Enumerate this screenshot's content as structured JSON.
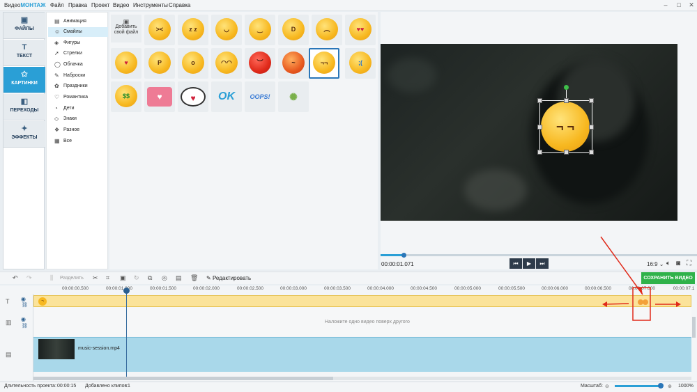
{
  "app": {
    "title_prefix": "Видео",
    "title_brand": "МОНТАЖ"
  },
  "menu": [
    "Файл",
    "Правка",
    "Проект",
    "Видео",
    "Инструменты",
    "Справка"
  ],
  "nav": [
    {
      "label": "ФАЙЛЫ",
      "icon": "image-icon"
    },
    {
      "label": "ТЕКСТ",
      "icon": "text-icon"
    },
    {
      "label": "КАРТИНКИ",
      "icon": "star-icon"
    },
    {
      "label": "ПЕРЕХОДЫ",
      "icon": "transitions-icon"
    },
    {
      "label": "ЭФФЕКТЫ",
      "icon": "magic-wand-icon"
    }
  ],
  "categories": [
    "Анимация",
    "Смайлы",
    "Фигуры",
    "Стрелки",
    "Облачка",
    "Наброски",
    "Праздники",
    "Романтика",
    "Дети",
    "Знаки",
    "Разное",
    "Все"
  ],
  "add_file": {
    "line1": "Добавить",
    "line2": "свой файл"
  },
  "stickers": {
    "ok": "OK",
    "oops": "OOPS!"
  },
  "player": {
    "timecode": "00:00:01.071",
    "ratio": "16:9",
    "progress": 0.07
  },
  "toolbar": {
    "split": "Разделить",
    "edit": "Редактировать",
    "save": "СОХРАНИТЬ ВИДЕО"
  },
  "ruler": [
    "00:00:00.500",
    "00:00:01.000",
    "00:00:01.500",
    "00:00:02.000",
    "00:00:02.500",
    "00:00:03.000",
    "00:00:03.500",
    "00:00:04.000",
    "00:00:04.500",
    "00:00:05.000",
    "00:00:05.500",
    "00:00:06.000",
    "00:00:06.500",
    "00:00:07.000",
    "00:00:07.1"
  ],
  "timeline": {
    "overlay_hint": "Наложите одно видео поверх другого",
    "clip_name": "music-session.mp4"
  },
  "status": {
    "duration_label": "Длительность проекта:",
    "duration": "00:00:15",
    "clips_label": "Добавлено клипов:",
    "clips": "1",
    "zoom_label": "Масштаб:",
    "zoom": "1000%"
  },
  "colors": {
    "accent": "#2a9fd6",
    "save": "#2fb24a",
    "annotation": "#e02a1a"
  }
}
